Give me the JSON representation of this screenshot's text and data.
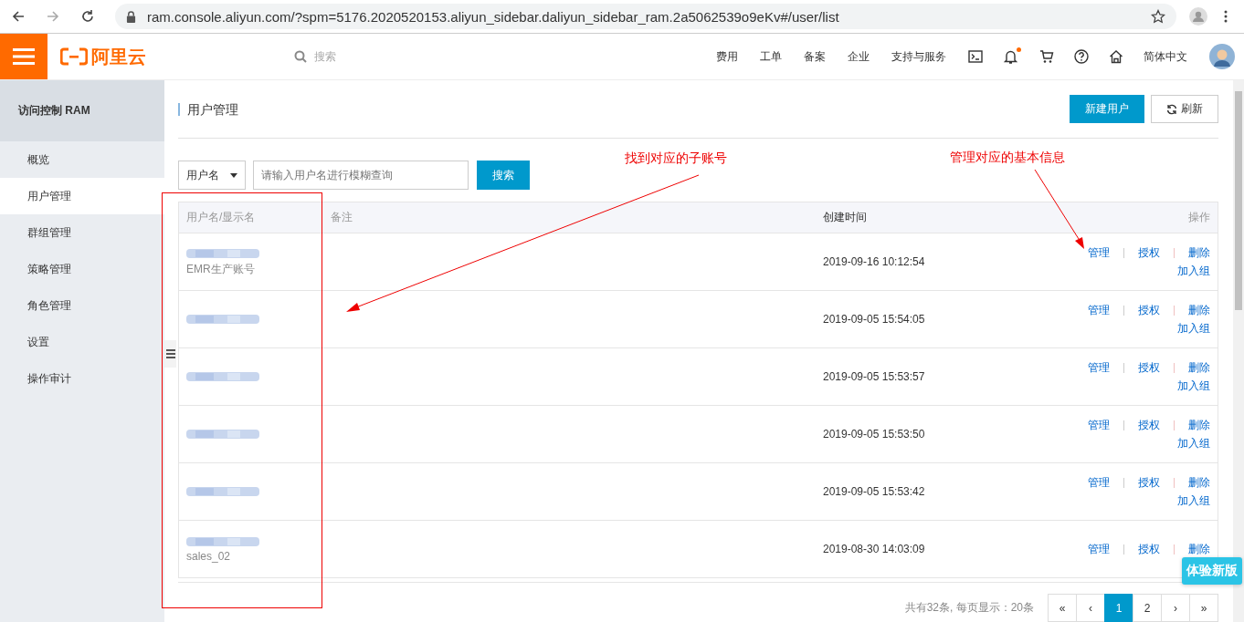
{
  "browser": {
    "url": "ram.console.aliyun.com/?spm=5176.2020520153.aliyun_sidebar.daliyun_sidebar_ram.2a5062539o9eKv#/user/list"
  },
  "header": {
    "logo": "阿里云",
    "search_placeholder": "搜索",
    "nav": [
      "费用",
      "工单",
      "备案",
      "企业",
      "支持与服务"
    ],
    "icons": [
      {
        "kind": "terminal",
        "dot": false
      },
      {
        "kind": "bell",
        "dot": true
      },
      {
        "kind": "cart",
        "dot": false
      },
      {
        "kind": "help",
        "dot": false
      },
      {
        "kind": "home",
        "dot": false
      }
    ],
    "language": "简体中文"
  },
  "sidebar": {
    "title": "访问控制 RAM",
    "items": [
      {
        "label": "概览",
        "selected": false
      },
      {
        "label": "用户管理",
        "selected": true
      },
      {
        "label": "群组管理",
        "selected": false
      },
      {
        "label": "策略管理",
        "selected": false
      },
      {
        "label": "角色管理",
        "selected": false
      },
      {
        "label": "设置",
        "selected": false
      },
      {
        "label": "操作审计",
        "selected": false
      }
    ]
  },
  "page": {
    "title": "用户管理",
    "buttons": [
      {
        "label": "新建用户",
        "kind": "primary"
      },
      {
        "label": "刷新",
        "kind": "refresh"
      }
    ]
  },
  "filter": {
    "field": "用户名",
    "placeholder": "请输入用户名进行模糊查询",
    "search_button": "搜索"
  },
  "table": {
    "columns": [
      "用户名/显示名",
      "备注",
      "创建时间",
      "操作"
    ],
    "rows": [
      {
        "display_name": "EMR生产账号",
        "created": "2019-09-16 10:12:54",
        "actions": [
          "管理",
          "授权",
          "删除",
          "加入组"
        ]
      },
      {
        "created": "2019-09-05 15:54:05",
        "actions": [
          "管理",
          "授权",
          "删除",
          "加入组"
        ]
      },
      {
        "created": "2019-09-05 15:53:57",
        "actions": [
          "管理",
          "授权",
          "删除",
          "加入组"
        ]
      },
      {
        "created": "2019-09-05 15:53:50",
        "actions": [
          "管理",
          "授权",
          "删除",
          "加入组"
        ]
      },
      {
        "created": "2019-09-05 15:53:42",
        "actions": [
          "管理",
          "授权",
          "删除",
          "加入组"
        ]
      },
      {
        "display_name": "sales_02",
        "created": "2019-08-30 14:03:09",
        "actions": [
          "管理",
          "授权",
          "删除"
        ]
      }
    ]
  },
  "pagination": {
    "summary": "共有32条, 每页显示：20条",
    "pages": [
      {
        "label": "«",
        "selected": false
      },
      {
        "label": "‹",
        "selected": false
      },
      {
        "label": "1",
        "selected": true
      },
      {
        "label": "2",
        "selected": false
      },
      {
        "label": "›",
        "selected": false
      },
      {
        "label": "»",
        "selected": false
      }
    ]
  },
  "annotations": [
    "找到对应的子账号",
    "管理对应的基本信息"
  ],
  "try_new_button": "体验新版"
}
